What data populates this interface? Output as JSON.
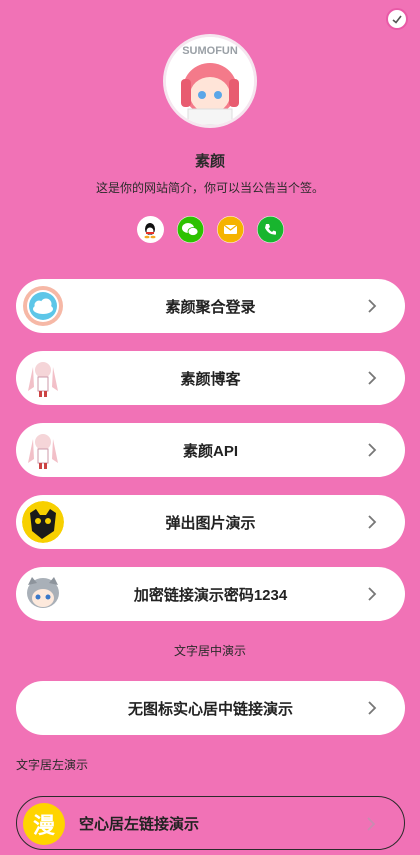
{
  "profile": {
    "avatar_text": "SUMOFUN",
    "name": "素颜",
    "bio": "这是你的网站简介，你可以当公告当个签。"
  },
  "socials": [
    {
      "icon": "qq-icon",
      "color": "#111111"
    },
    {
      "icon": "wechat-icon",
      "color": "#2dc100"
    },
    {
      "icon": "email-icon",
      "color": "#f5b300"
    },
    {
      "icon": "phone-icon",
      "color": "#18b52e"
    }
  ],
  "links": [
    {
      "label": "素颜聚合登录",
      "icon": "cloud-icon"
    },
    {
      "label": "素颜博客",
      "icon": "anime-girl-icon"
    },
    {
      "label": "素颜API",
      "icon": "anime-girl-icon"
    },
    {
      "label": "弹出图片演示",
      "icon": "cat-icon"
    },
    {
      "label": "加密链接演示密码1234",
      "icon": "anime-gray-girl-icon"
    }
  ],
  "center_caption": "文字居中演示",
  "center_link": {
    "label": "无图标实心居中链接演示"
  },
  "left_caption": "文字居左演示",
  "left_link": {
    "label": "空心居左链接演示",
    "badge": "漫"
  },
  "colors": {
    "background": "#f172b6",
    "card": "#ffffff",
    "text": "#222222"
  }
}
